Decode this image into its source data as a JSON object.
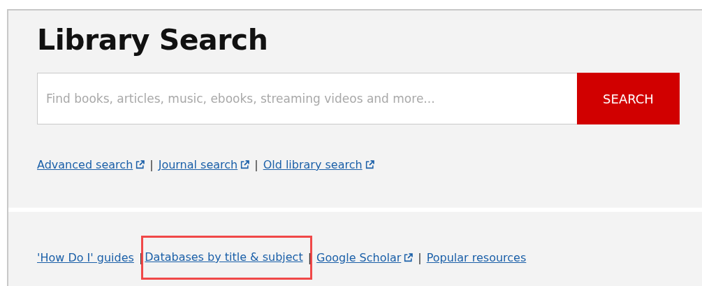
{
  "title": "Library Search",
  "search": {
    "placeholder": "Find books, articles, music, ebooks, streaming videos and more...",
    "button": "SEARCH"
  },
  "separator": "|",
  "search_links": [
    {
      "label": "Advanced search",
      "external": true
    },
    {
      "label": "Journal search",
      "external": true
    },
    {
      "label": "Old library search",
      "external": true
    }
  ],
  "resource_links": [
    {
      "label": "'How Do I' guides",
      "external": false,
      "highlighted": false
    },
    {
      "label": "Databases by title & subject",
      "external": false,
      "highlighted": true
    },
    {
      "label": "Google Scholar",
      "external": true,
      "highlighted": false
    },
    {
      "label": "Popular resources",
      "external": false,
      "highlighted": false
    }
  ]
}
